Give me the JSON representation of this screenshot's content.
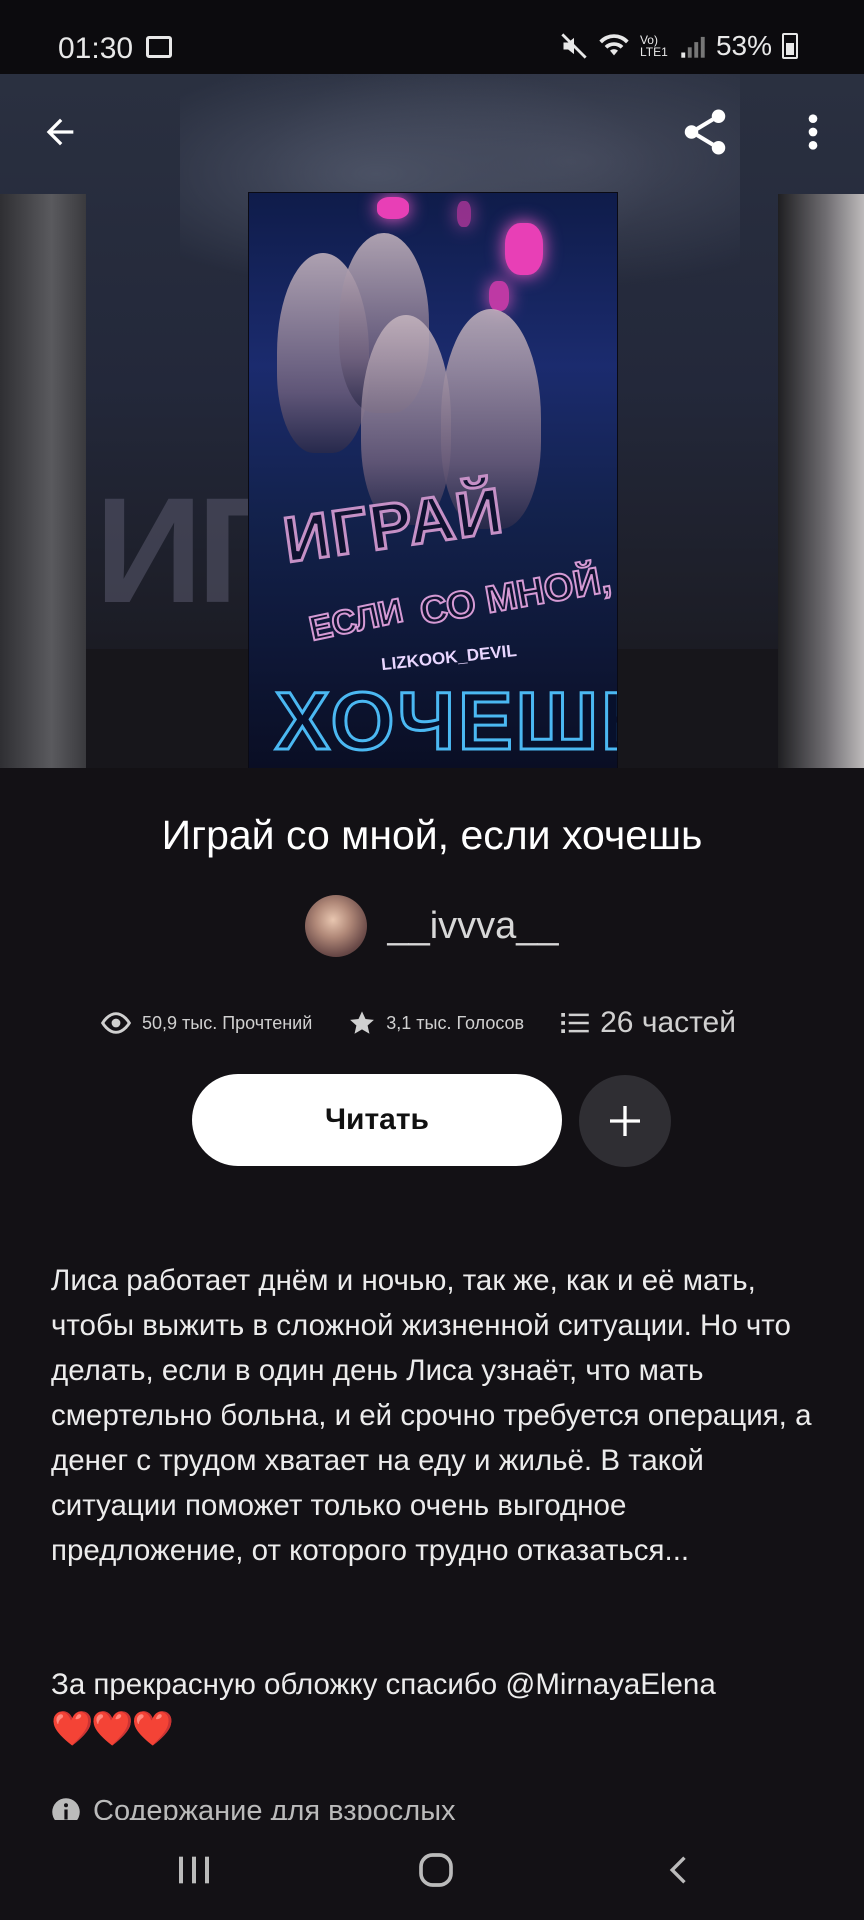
{
  "status_bar": {
    "time": "01:30",
    "battery": "53%",
    "network": "Vo) LTE1"
  },
  "toolbar": {
    "back_icon": "arrow-left-icon",
    "share_icon": "share-icon",
    "more_icon": "more-vertical-icon"
  },
  "cover": {
    "line1": "ИГРАЙ",
    "line2": "ЕСЛИ",
    "line3": "СО МНОЙ,",
    "author_tag": "LIZKOOK_DEVIL",
    "line4": "ХОЧЕШЬ",
    "background_word": "ИГ"
  },
  "story": {
    "title": "Играй со мной, если хочешь",
    "author": "__ivvva__"
  },
  "stats": {
    "reads": "50,9 тыс. Прочтений",
    "votes": "3,1 тыс. Голосов",
    "parts": "26 частей"
  },
  "actions": {
    "read_label": "Читать",
    "add_icon": "plus-icon"
  },
  "description": "Лиса работает днём и ночью, так же, как и её мать, чтобы выжить в сложной жизненной ситуации. Но что делать, если в один день Лиса узнаёт, что мать смертельно больна, и ей срочно требуется операция, а денег с трудом хватает на еду и жильё. В такой ситуации поможет только очень выгодное предложение, от которого трудно отказаться...",
  "thanks": "За прекрасную обложку спасибо @MirnayaElena",
  "hearts": "❤️❤️❤️",
  "mature_label": "Содержание для взрослых",
  "colors": {
    "background": "#131115",
    "accent_button": "#ffffff",
    "add_button": "#2f2e33",
    "heart": "#e5342c"
  }
}
